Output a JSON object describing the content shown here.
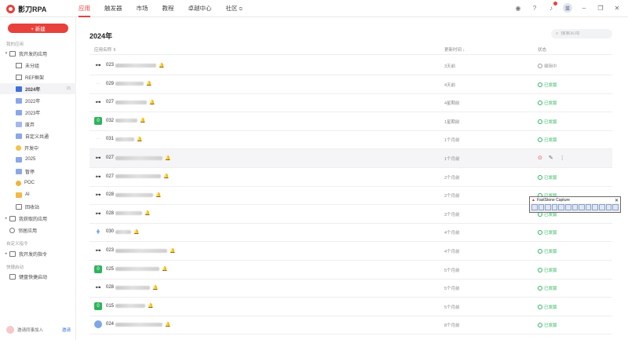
{
  "app": {
    "logo_text": "影刀RPA"
  },
  "nav": {
    "tabs": [
      {
        "label": "应用",
        "active": true
      },
      {
        "label": "触发器",
        "active": false
      },
      {
        "label": "市场",
        "active": false
      },
      {
        "label": "教程",
        "active": false
      },
      {
        "label": "卓越中心",
        "active": false
      },
      {
        "label": "社区",
        "active": false
      }
    ],
    "avatar_text": "菜"
  },
  "sidebar": {
    "new_button": "+ 新建",
    "section_my_apps": "我的应用",
    "my_dev_apps": "我开发的应用",
    "folders": [
      {
        "label": "未分组"
      },
      {
        "label": "REF框架"
      },
      {
        "label": "2024年",
        "count": "15",
        "selected": true
      },
      {
        "label": "2022年"
      },
      {
        "label": "2023年"
      },
      {
        "label": "废弃"
      },
      {
        "label": "自定义共通"
      },
      {
        "label": "开发中"
      },
      {
        "label": "2025"
      },
      {
        "label": "暂停"
      },
      {
        "label": "POC"
      },
      {
        "label": "AI"
      },
      {
        "label": "回收站"
      }
    ],
    "obtained_apps": "我获取的应用",
    "shared_apps": "邻居应用",
    "section_custom_cmd": "自定义指令",
    "my_dev_cmds": "我开发的指令",
    "section_quick_start": "快捷启动",
    "quick_start_item": "键盘快捷启动",
    "invite_text": "邀请同事加入",
    "invite_link": "邀请"
  },
  "main": {
    "title": "2024年",
    "search_placeholder": "搜索应用",
    "columns": {
      "name": "应用名称 ⇕",
      "updated": "更新时间 ↓",
      "status": "状态"
    },
    "rows": [
      {
        "id": "023",
        "icon": "flow",
        "time": "3天前",
        "status": "编辑中"
      },
      {
        "id": "029",
        "icon": "grey",
        "time": "4天前",
        "status": "已发版"
      },
      {
        "id": "027",
        "icon": "flow",
        "time": "4星期前",
        "status": "已发版"
      },
      {
        "id": "032",
        "icon": "green",
        "time": "1星期前",
        "status": "已发版"
      },
      {
        "id": "031",
        "icon": "grey",
        "time": "1个月前",
        "status": "已发版"
      },
      {
        "id": "027",
        "icon": "flow",
        "time": "1个月前",
        "status": "",
        "hover": true
      },
      {
        "id": "027",
        "icon": "flow",
        "time": "2个月前",
        "status": "已发版"
      },
      {
        "id": "028",
        "icon": "flow",
        "time": "2个月前",
        "status": "已发版"
      },
      {
        "id": "028",
        "icon": "flow",
        "time": "3个月前",
        "status": "已发版"
      },
      {
        "id": "030",
        "icon": "blue",
        "time": "4个月前",
        "status": "已发版"
      },
      {
        "id": "023",
        "icon": "flow",
        "time": "4个月前",
        "status": "已发版"
      },
      {
        "id": "025",
        "icon": "green",
        "time": "5个月前",
        "status": "已发版"
      },
      {
        "id": "028",
        "icon": "flow",
        "time": "5个月前",
        "status": "已发版"
      },
      {
        "id": "015",
        "icon": "green",
        "time": "5个月前",
        "status": "已发版"
      },
      {
        "id": "024",
        "icon": "globe",
        "time": "8个月前",
        "status": "已发版"
      }
    ]
  },
  "faststone": {
    "title": "FastStone Capture"
  },
  "colors": {
    "accent": "#e8413b",
    "published": "#2fb35d"
  }
}
